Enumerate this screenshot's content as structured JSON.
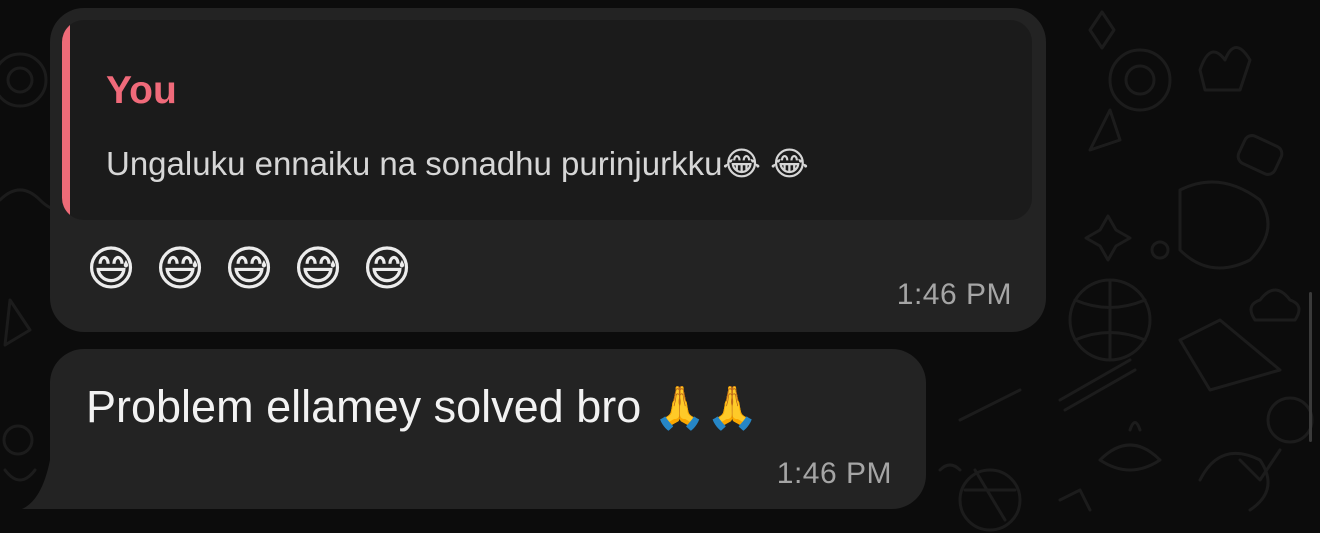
{
  "messages": [
    {
      "quote": {
        "author": "You",
        "text": "Ungaluku ennaiku na sonadhu purinjurkku😂 😂"
      },
      "emojis": [
        "😅",
        "😅",
        "😅",
        "😅",
        "😅"
      ],
      "time": "1:46 PM"
    },
    {
      "text": "Problem ellamey solved bro",
      "emoji": "🙏🙏",
      "time": "1:46 PM"
    }
  ],
  "colors": {
    "bubble": "#232323",
    "quote_background": "#1b1b1b",
    "quote_accent": "#ee6b78",
    "author_name": "#f06a7a",
    "timestamp": "#a5a5a5",
    "wallpaper": "#0c0c0c"
  }
}
